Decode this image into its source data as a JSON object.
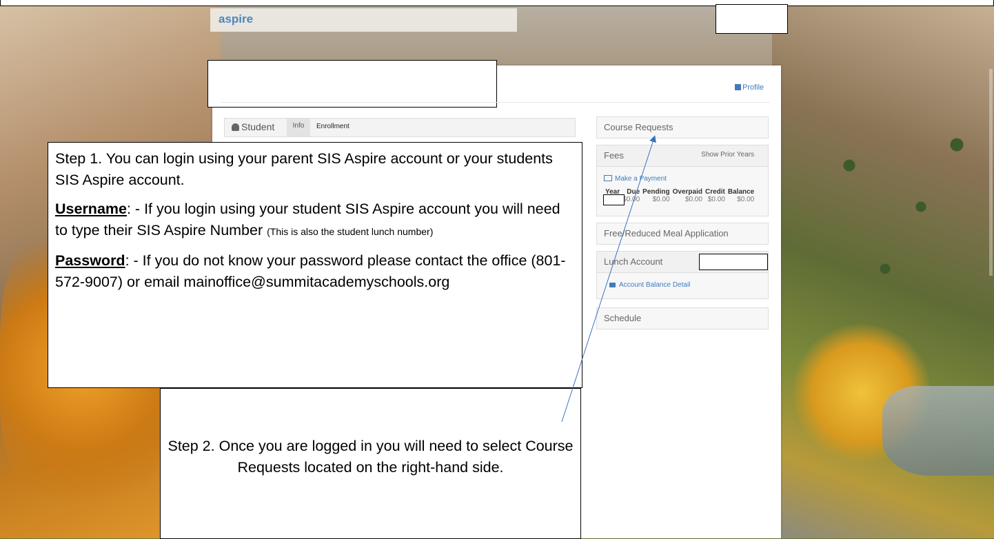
{
  "brand": "aspire",
  "header": {
    "profile_label": "Profile"
  },
  "student_tabs": {
    "student": "Student",
    "info": "Info",
    "enrollment": "Enrollment"
  },
  "right_panel": {
    "course_requests": "Course Requests",
    "fees": {
      "title": "Fees",
      "show_prior": "Show Prior Years",
      "make_payment": "Make a Payment",
      "columns": [
        "Year",
        "Due",
        "Pending",
        "Overpaid",
        "Credit",
        "Balance"
      ],
      "row": [
        "",
        "$0.00",
        "$0.00",
        "$0.00",
        "$0.00",
        "$0.00"
      ]
    },
    "free_reduced": "Free/Reduced Meal Application",
    "lunch": {
      "title": "Lunch Account",
      "balance_detail": "Account Balance Detail"
    },
    "schedule": "Schedule"
  },
  "step1": {
    "line1": "Step 1. You can login using your parent SIS Aspire account or your students SIS Aspire account.",
    "username_label": "Username",
    "username_text": ": - If you login using your student SIS Aspire account you will need to type their SIS Aspire Number ",
    "username_note": "(This is also the student lunch number)",
    "password_label": "Password",
    "password_text": ": - If you do not know your password please contact the office (801-572-9007) or email mainoffice@summitacademyschools.org"
  },
  "step2": {
    "text": "Step 2.  Once you are logged in you will need to select Course Requests located on the right-hand side."
  },
  "colors": {
    "link": "#3f7bbd",
    "brand": "#4a86c0",
    "arrow": "#3b72b9"
  }
}
